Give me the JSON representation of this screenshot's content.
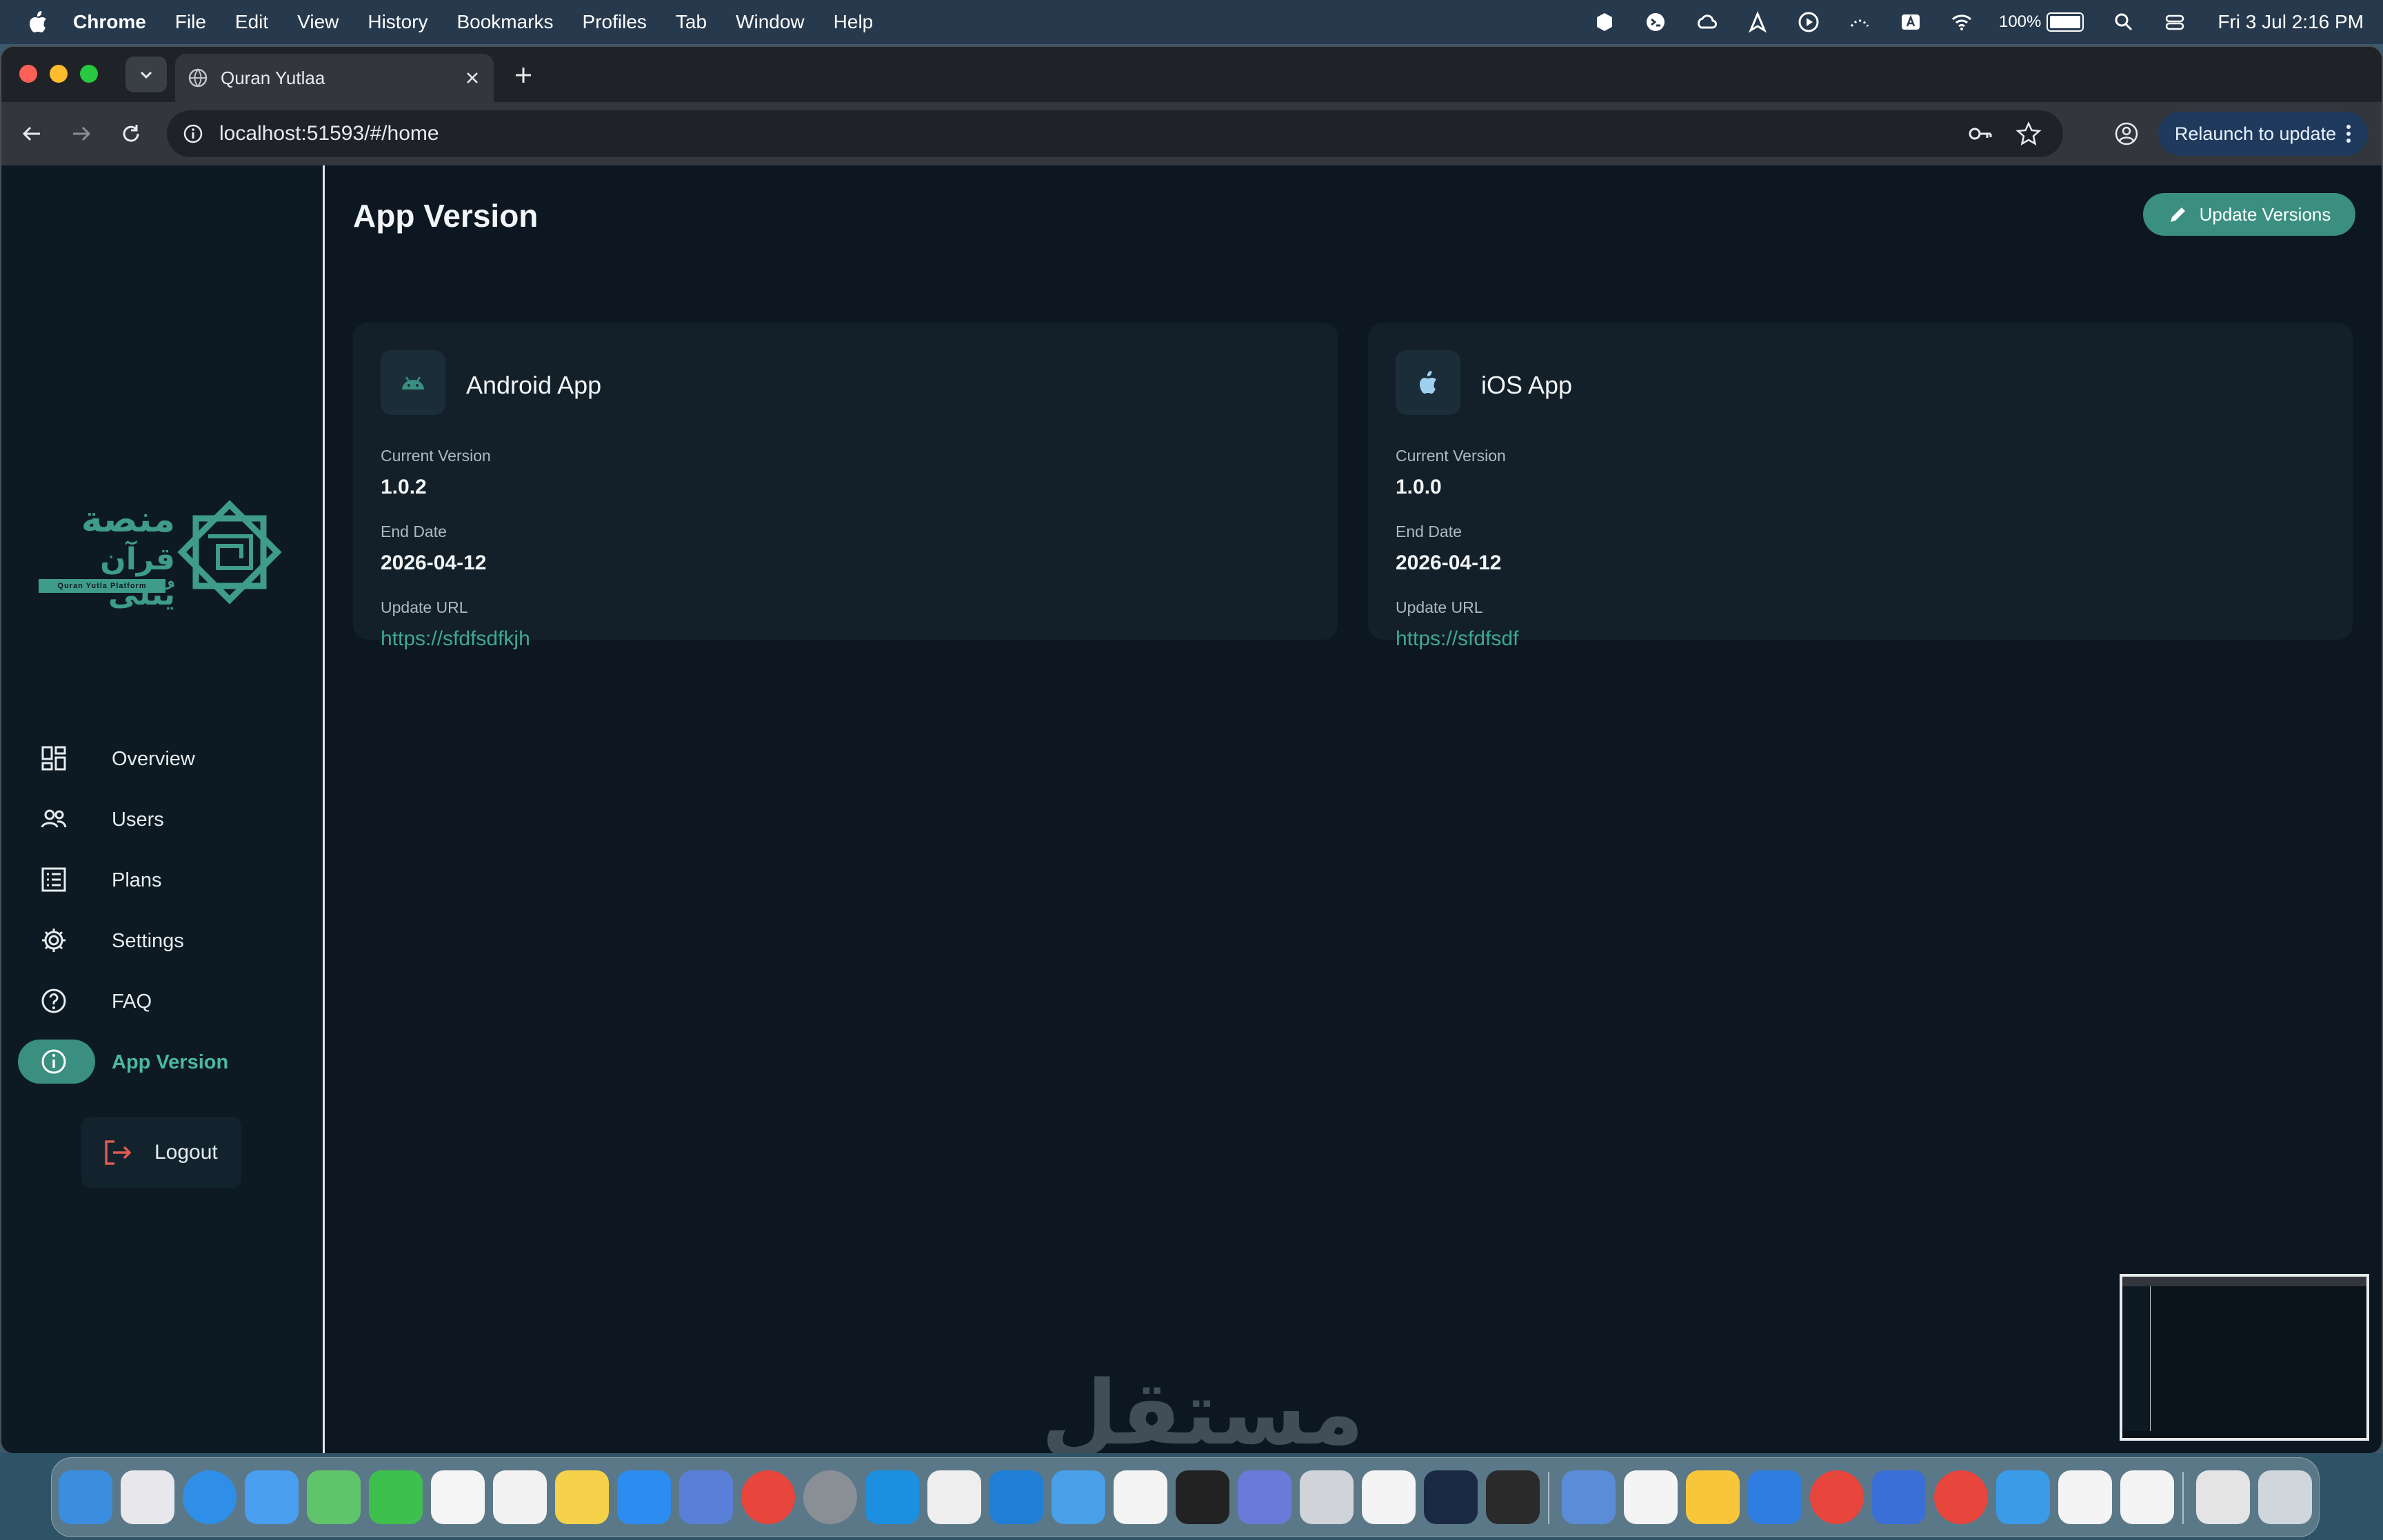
{
  "menubar": {
    "app_name": "Chrome",
    "menus": [
      "File",
      "Edit",
      "View",
      "History",
      "Bookmarks",
      "Profiles",
      "Tab",
      "Window",
      "Help"
    ],
    "battery": "100%",
    "clock": "Fri 3 Jul  2:16 PM"
  },
  "browser": {
    "tab_title": "Quran Yutlaa",
    "url": "localhost:51593/#/home",
    "relaunch_label": "Relaunch to update"
  },
  "sidebar": {
    "logo": {
      "arabic_line1": "منصة",
      "arabic_line2": "قرآن يُتلى",
      "english": "Quran Yutla Platform"
    },
    "items": [
      {
        "label": "Overview",
        "icon": "dashboard-icon"
      },
      {
        "label": "Users",
        "icon": "users-icon"
      },
      {
        "label": "Plans",
        "icon": "list-icon"
      },
      {
        "label": "Settings",
        "icon": "gear-icon"
      },
      {
        "label": "FAQ",
        "icon": "help-circle-icon"
      },
      {
        "label": "App Version",
        "icon": "info-icon",
        "active": true
      }
    ],
    "logout_label": "Logout"
  },
  "main": {
    "title": "App Version",
    "update_button": "Update Versions",
    "cards": [
      {
        "name": "Android App",
        "icon": "android-icon",
        "current_version_label": "Current Version",
        "current_version": "1.0.2",
        "end_date_label": "End Date",
        "end_date": "2026-04-12",
        "update_url_label": "Update URL",
        "update_url": "https://sfdfsdfkjh"
      },
      {
        "name": "iOS App",
        "icon": "apple-icon",
        "current_version_label": "Current Version",
        "current_version": "1.0.0",
        "end_date_label": "End Date",
        "end_date": "2026-04-12",
        "update_url_label": "Update URL",
        "update_url": "https://sfdfsdf"
      }
    ]
  },
  "watermark": "مستقل",
  "colors": {
    "accent": "#3a8f80",
    "link": "#3fa893",
    "background": "#0d1722",
    "card": "#132029"
  }
}
